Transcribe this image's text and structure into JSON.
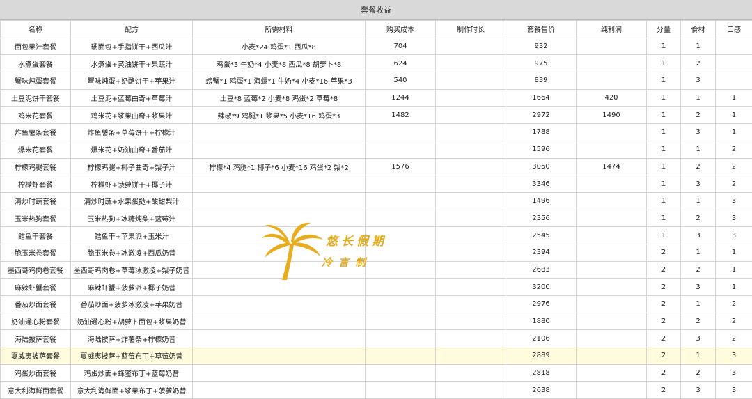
{
  "sheet": {
    "title": "套餐收益",
    "headers": [
      "名称",
      "配方",
      "所需材料",
      "购买成本",
      "制作时长",
      "套餐售价",
      "纯利润",
      "分量",
      "食材",
      "口感"
    ],
    "rows": [
      [
        "面包果汁套餐",
        "硬面包+手指饼干+西瓜汁",
        "小麦*24 鸡蛋*1 西瓜*8",
        "704",
        "",
        "932",
        "",
        "1",
        "1",
        ""
      ],
      [
        "水煮蛋套餐",
        "水煮蛋+黄油饼干+果蔬汁",
        "鸡蛋*3 牛奶*4 小麦*8 西瓜*8 胡萝卜*8",
        "624",
        "",
        "975",
        "",
        "1",
        "2",
        ""
      ],
      [
        "蟹味炖蛋套餐",
        "蟹味炖蛋+奶酪饼干+苹果汁",
        "螃蟹*1 鸡蛋*1 海螺*1 牛奶*4 小麦*16 苹果*3",
        "540",
        "",
        "839",
        "",
        "1",
        "3",
        ""
      ],
      [
        "土豆泥饼干套餐",
        "土豆泥+蓝莓曲奇+草莓汁",
        "土豆*8 蓝莓*2 小麦*8 鸡蛋*2 草莓*8",
        "1244",
        "",
        "1664",
        "420",
        "1",
        "1",
        "1"
      ],
      [
        "鸡米花套餐",
        "鸡米花+浆果曲奇+浆果汁",
        "辣椒*9 鸡腿*1 浆果*5 小麦*16 鸡蛋*3",
        "1482",
        "",
        "2972",
        "1490",
        "1",
        "2",
        "1"
      ],
      [
        "炸鱼薯条套餐",
        "炸鱼薯条+草莓饼干+柠檬汁",
        "",
        "",
        "",
        "1788",
        "",
        "1",
        "3",
        "1"
      ],
      [
        "爆米花套餐",
        "爆米花+奶油曲奇+番茄汁",
        "",
        "",
        "",
        "1596",
        "",
        "1",
        "1",
        "2"
      ],
      [
        "柠檬鸡腿套餐",
        "柠檬鸡腿+椰子曲奇+梨子汁",
        "柠檬*4 鸡腿*1 椰子*6 小麦*16 鸡蛋*2 梨*2",
        "1576",
        "",
        "3050",
        "1474",
        "1",
        "2",
        "2"
      ],
      [
        "柠檬虾套餐",
        "柠檬虾+菠萝饼干+椰子汁",
        "",
        "",
        "",
        "3346",
        "",
        "1",
        "3",
        "2"
      ],
      [
        "清炒时蔬套餐",
        "清炒时蔬+水果蛋挞+酸甜梨汁",
        "",
        "",
        "",
        "1496",
        "",
        "1",
        "1",
        "3"
      ],
      [
        "玉米热狗套餐",
        "玉米热狗+冰糖炖梨+蓝莓汁",
        "",
        "",
        "",
        "2356",
        "",
        "1",
        "2",
        "3"
      ],
      [
        "鳕鱼干套餐",
        "鳕鱼干+苹果派+玉米汁",
        "",
        "",
        "",
        "2545",
        "",
        "1",
        "3",
        "3"
      ],
      [
        "脆玉米卷套餐",
        "脆玉米卷+冰激凌+西瓜奶昔",
        "",
        "",
        "",
        "2394",
        "",
        "2",
        "1",
        "1"
      ],
      [
        "墨西哥鸡肉卷套餐",
        "墨西哥鸡肉卷+草莓冰激凌+梨子奶昔",
        "",
        "",
        "",
        "2683",
        "",
        "2",
        "2",
        "1"
      ],
      [
        "麻辣虾蟹套餐",
        "麻辣虾蟹+菠萝派+椰子奶昔",
        "",
        "",
        "",
        "3200",
        "",
        "2",
        "3",
        "1"
      ],
      [
        "番茄炒面套餐",
        "番茄炒面+菠萝冰激凌+苹果奶昔",
        "",
        "",
        "",
        "2976",
        "",
        "2",
        "1",
        "2"
      ],
      [
        "奶油通心粉套餐",
        "奶油通心粉+胡萝卜面包+浆果奶昔",
        "",
        "",
        "",
        "1880",
        "",
        "2",
        "2",
        "2"
      ],
      [
        "海陆披萨套餐",
        "海陆披萨+炸薯条+柠檬奶昔",
        "",
        "",
        "",
        "2106",
        "",
        "2",
        "3",
        "2"
      ],
      [
        "夏威夷披萨套餐",
        "夏威夷披萨+蓝莓布丁+草莓奶昔",
        "",
        "",
        "",
        "2889",
        "",
        "2",
        "1",
        "3"
      ],
      [
        "鸡蛋炒面套餐",
        "鸡蛋炒面+蜂蜜布丁+蓝莓奶昔",
        "",
        "",
        "",
        "2818",
        "",
        "2",
        "2",
        "3"
      ],
      [
        "意大利海鲜面套餐",
        "意大利海鲜面+浆果布丁+菠萝奶昔",
        "",
        "",
        "",
        "2638",
        "",
        "2",
        "3",
        "3"
      ]
    ],
    "highlight_row": 18
  },
  "watermark": {
    "line1": "悠长假期",
    "line2": "冷言制",
    "icon": "palm-tree-icon",
    "color": "#e6ad1f"
  }
}
